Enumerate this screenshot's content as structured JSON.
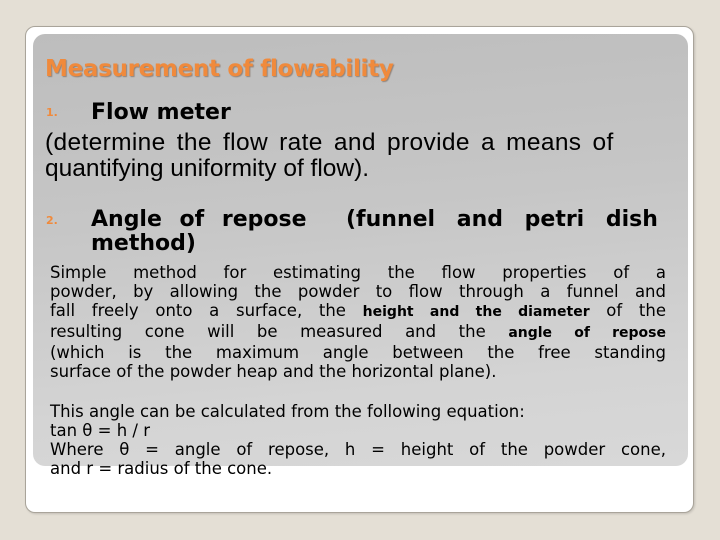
{
  "slide": {
    "title": "Measurement of flowability",
    "item1": {
      "number": "1.",
      "heading": "Flow meter",
      "description_line1": "(determine the flow rate and provide a means of",
      "description_line2": "quantifying uniformity of flow)."
    },
    "item2": {
      "number": "2.",
      "heading_part1": "Angle of repose",
      "heading_part2": "(funnel and petri dish",
      "heading_line2": "method)",
      "paragraph": {
        "line1": "Simple method for estimating the flow properties of a",
        "line2": "powder, by allowing the powder to flow through a funnel and",
        "line3_pre": "fall freely onto a surface, the ",
        "line3_bold": "height and the diameter",
        "line3_post": " of the",
        "line4_pre": "resulting cone will be measured and the ",
        "line4_bold": "angle of repose",
        "line5": "(which is the maximum angle between the free standing",
        "line6": "surface of the powder heap and the horizontal plane)."
      }
    },
    "equation_block": {
      "line1": "This angle can be calculated from the following equation:",
      "line2": "tan θ = h / r",
      "line3": "Where θ = angle of repose, h = height of the powder cone,",
      "line4": "and r = radius of the cone."
    },
    "colors": {
      "accent": "#f08a3c",
      "background": "#e4dfd5",
      "panel": "#c6c6c6"
    }
  }
}
